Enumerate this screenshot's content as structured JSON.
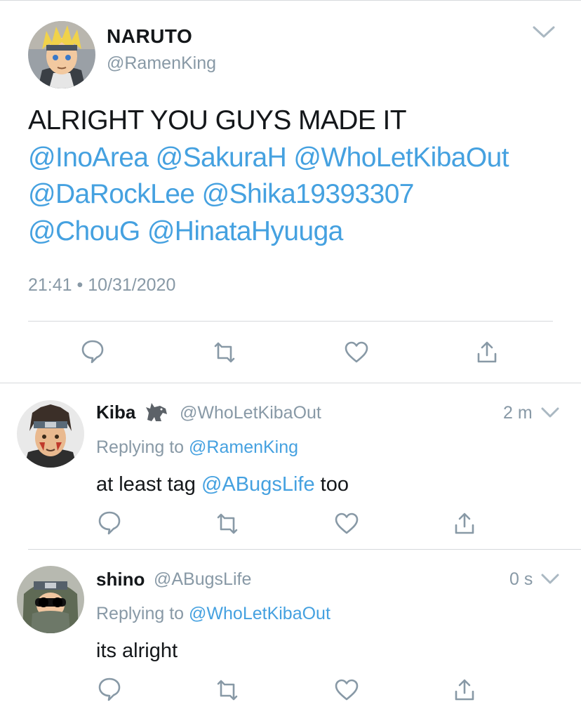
{
  "main_tweet": {
    "name": "NARUTO",
    "handle": "@RamenKing",
    "text_plain": "ALRIGHT YOU GUYS MADE IT",
    "mentions": [
      "@InoArea",
      "@SakuraH",
      "@WhoLetKibaOut",
      "@DaRockLee",
      "@Shika19393307",
      "@ChouG",
      "@HinataHyuuga"
    ],
    "time": "21:41",
    "dot": "•",
    "date": "10/31/2020"
  },
  "replies": [
    {
      "name": "Kiba",
      "handle": "@WhoLetKibaOut",
      "time": "2 m",
      "replying_prefix": "Replying to",
      "replying_to": "@RamenKing",
      "text_before": "at least tag",
      "text_mention": "@ABugsLife",
      "text_after": "too"
    },
    {
      "name": "shino",
      "handle": "@ABugsLife",
      "time": "0 s",
      "replying_prefix": "Replying to",
      "replying_to": "@WhoLetKibaOut",
      "text": "its alright"
    }
  ],
  "icons": {
    "reply": "reply-icon",
    "retweet": "retweet-icon",
    "like": "heart-icon",
    "share": "share-icon",
    "menu": "chevron-down-icon"
  },
  "colors": {
    "mention": "#45a1e0",
    "muted": "#8899a6",
    "text": "#14171a",
    "divider": "#d6d9dc"
  }
}
